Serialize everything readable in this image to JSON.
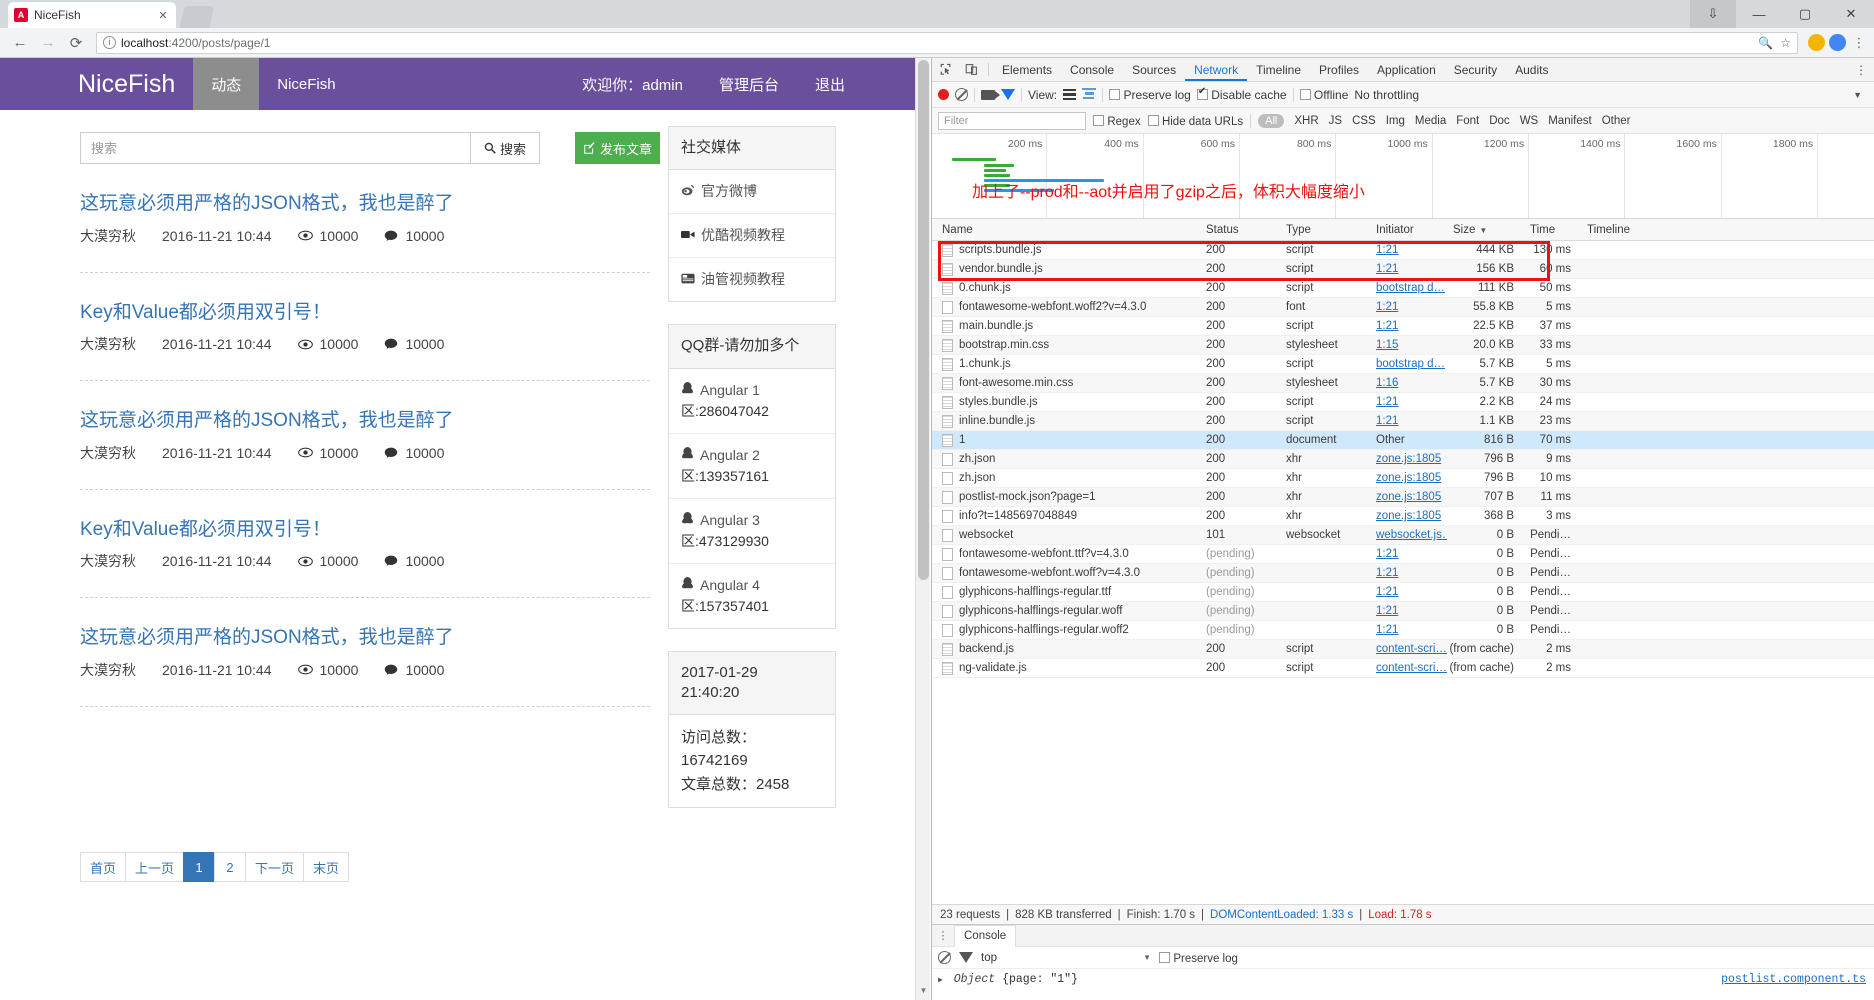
{
  "browser": {
    "tab": {
      "title": "NiceFish",
      "favicon_letter": "A",
      "close_label": "✕"
    },
    "window": {
      "minimize": "—",
      "maximize": "▢",
      "close": "✕",
      "download": "⇩"
    },
    "nav": {
      "back": "←",
      "forward": "→",
      "reload": "⟳"
    },
    "omnibox": {
      "info_icon": "ⓘ",
      "url_host": "localhost",
      "url_rest": ":4200/posts/page/1",
      "zoom_icon": "🔍",
      "star_icon": "☆"
    }
  },
  "site": {
    "brand": "NiceFish",
    "nav_items": [
      {
        "label": "动态",
        "active": true
      },
      {
        "label": "NiceFish",
        "active": false
      }
    ],
    "nav_right": [
      {
        "label": "欢迎你：admin"
      },
      {
        "label": "管理后台"
      },
      {
        "label": "退出"
      }
    ],
    "search": {
      "placeholder": "搜索",
      "button_label": "搜索",
      "icon": "search-icon",
      "value": ""
    },
    "publish_button": {
      "label": "发布文章",
      "icon": "pencil-square-icon"
    },
    "posts": [
      {
        "title": "这玩意必须用严格的JSON格式，我也是醉了",
        "author": "大漠穷秋",
        "date": "2016-11-21 10:44",
        "views": "10000",
        "comments": "10000"
      },
      {
        "title": "Key和Value都必须用双引号！",
        "author": "大漠穷秋",
        "date": "2016-11-21 10:44",
        "views": "10000",
        "comments": "10000"
      },
      {
        "title": "这玩意必须用严格的JSON格式，我也是醉了",
        "author": "大漠穷秋",
        "date": "2016-11-21 10:44",
        "views": "10000",
        "comments": "10000"
      },
      {
        "title": "Key和Value都必须用双引号！",
        "author": "大漠穷秋",
        "date": "2016-11-21 10:44",
        "views": "10000",
        "comments": "10000"
      },
      {
        "title": "这玩意必须用严格的JSON格式，我也是醉了",
        "author": "大漠穷秋",
        "date": "2016-11-21 10:44",
        "views": "10000",
        "comments": "10000"
      }
    ],
    "pagination": [
      {
        "label": "首页",
        "active": false
      },
      {
        "label": "上一页",
        "active": false
      },
      {
        "label": "1",
        "active": true
      },
      {
        "label": "2",
        "active": false
      },
      {
        "label": "下一页",
        "active": false
      },
      {
        "label": "末页",
        "active": false
      }
    ],
    "widgets": {
      "social": {
        "title": "社交媒体",
        "items": [
          {
            "label": "官方微博",
            "icon": "weibo-icon"
          },
          {
            "label": "优酷视频教程",
            "icon": "video-camera-icon"
          },
          {
            "label": "油管视频教程",
            "icon": "youtube-icon"
          }
        ]
      },
      "qq": {
        "title": "QQ群-请勿加多个",
        "items": [
          {
            "name": "Angular 1",
            "number": "区:286047042",
            "icon": "qq-icon"
          },
          {
            "name": "Angular 2",
            "number": "区:139357161",
            "icon": "qq-icon"
          },
          {
            "name": "Angular 3",
            "number": "区:473129930",
            "icon": "qq-icon"
          },
          {
            "name": "Angular 4",
            "number": "区:157357401",
            "icon": "qq-icon"
          }
        ]
      },
      "stats": {
        "datetime_date": "2017-01-29",
        "datetime_time": "21:40:20",
        "visits_label": "访问总数：",
        "visits_value": "16742169",
        "posts_label": "文章总数：2458"
      }
    }
  },
  "devtools": {
    "tabs": [
      {
        "label": "Elements",
        "active": false
      },
      {
        "label": "Console",
        "active": false
      },
      {
        "label": "Sources",
        "active": false
      },
      {
        "label": "Network",
        "active": true
      },
      {
        "label": "Timeline",
        "active": false
      },
      {
        "label": "Profiles",
        "active": false
      },
      {
        "label": "Application",
        "active": false
      },
      {
        "label": "Security",
        "active": false
      },
      {
        "label": "Audits",
        "active": false
      }
    ],
    "more_icon": "⋮",
    "inspect_icon": "cursor-arrow-icon",
    "device_icon": "device-toolbar-icon",
    "toolbar": {
      "record_icon": "record-icon",
      "clear_icon": "clear-icon",
      "capture_icon": "camera-icon",
      "filter_icon": "funnel-icon",
      "view_label": "View:",
      "view_list_icon": "list-view-icon",
      "view_waterfall_icon": "waterfall-view-icon",
      "preserve_log": {
        "label": "Preserve log",
        "checked": false
      },
      "disable_cache": {
        "label": "Disable cache",
        "checked": true
      },
      "offline": {
        "label": "Offline",
        "checked": false
      },
      "throttling": "No throttling",
      "throttling_arrow": "▼"
    },
    "filterbar": {
      "filter_placeholder": "Filter",
      "filter_value": "",
      "regex": {
        "label": "Regex",
        "checked": false
      },
      "hide_data_urls": {
        "label": "Hide data URLs",
        "checked": false
      },
      "types": [
        "All",
        "XHR",
        "JS",
        "CSS",
        "Img",
        "Media",
        "Font",
        "Doc",
        "WS",
        "Manifest",
        "Other"
      ],
      "active_type": "All"
    },
    "overview": {
      "ticks": [
        "200 ms",
        "400 ms",
        "600 ms",
        "800 ms",
        "1000 ms",
        "1200 ms",
        "1400 ms",
        "1600 ms",
        "1800 ms"
      ],
      "annotation": "加上了--prod和--aot并启用了gzip之后，体积大幅度缩小",
      "annotation_color": "#ee1111"
    },
    "columns": [
      "Name",
      "Status",
      "Type",
      "Initiator",
      "Size",
      "Time",
      "Timeline"
    ],
    "sorted_column": "Size",
    "sort_arrow": "▼",
    "requests": [
      {
        "name": "scripts.bundle.js",
        "status": "200",
        "type": "script",
        "initiator": "1:21",
        "size": "444 KB",
        "time": "130 ms",
        "icon": "script-file-icon",
        "highlight": true
      },
      {
        "name": "vendor.bundle.js",
        "status": "200",
        "type": "script",
        "initiator": "1:21",
        "size": "156 KB",
        "time": "60 ms",
        "icon": "script-file-icon",
        "highlight": true
      },
      {
        "name": "0.chunk.js",
        "status": "200",
        "type": "script",
        "initiator": "bootstrap d…",
        "size": "111 KB",
        "time": "50 ms",
        "icon": "script-file-icon"
      },
      {
        "name": "fontawesome-webfont.woff2?v=4.3.0",
        "status": "200",
        "type": "font",
        "initiator": "1:21",
        "size": "55.8 KB",
        "time": "5 ms",
        "icon": "plain-file-icon"
      },
      {
        "name": "main.bundle.js",
        "status": "200",
        "type": "script",
        "initiator": "1:21",
        "size": "22.5 KB",
        "time": "37 ms",
        "icon": "script-file-icon"
      },
      {
        "name": "bootstrap.min.css",
        "status": "200",
        "type": "stylesheet",
        "initiator": "1:15",
        "size": "20.0 KB",
        "time": "33 ms",
        "icon": "script-file-icon"
      },
      {
        "name": "1.chunk.js",
        "status": "200",
        "type": "script",
        "initiator": "bootstrap d…",
        "size": "5.7 KB",
        "time": "5 ms",
        "icon": "script-file-icon"
      },
      {
        "name": "font-awesome.min.css",
        "status": "200",
        "type": "stylesheet",
        "initiator": "1:16",
        "size": "5.7 KB",
        "time": "30 ms",
        "icon": "script-file-icon"
      },
      {
        "name": "styles.bundle.js",
        "status": "200",
        "type": "script",
        "initiator": "1:21",
        "size": "2.2 KB",
        "time": "24 ms",
        "icon": "script-file-icon"
      },
      {
        "name": "inline.bundle.js",
        "status": "200",
        "type": "script",
        "initiator": "1:21",
        "size": "1.1 KB",
        "time": "23 ms",
        "icon": "script-file-icon"
      },
      {
        "name": "1",
        "status": "200",
        "type": "document",
        "initiator": "Other",
        "size": "816 B",
        "time": "70 ms",
        "icon": "script-file-icon",
        "selected": true
      },
      {
        "name": "zh.json",
        "status": "200",
        "type": "xhr",
        "initiator": "zone.js:1805",
        "size": "796 B",
        "time": "9 ms",
        "icon": "plain-file-icon"
      },
      {
        "name": "zh.json",
        "status": "200",
        "type": "xhr",
        "initiator": "zone.js:1805",
        "size": "796 B",
        "time": "10 ms",
        "icon": "plain-file-icon"
      },
      {
        "name": "postlist-mock.json?page=1",
        "status": "200",
        "type": "xhr",
        "initiator": "zone.js:1805",
        "size": "707 B",
        "time": "11 ms",
        "icon": "plain-file-icon"
      },
      {
        "name": "info?t=1485697048849",
        "status": "200",
        "type": "xhr",
        "initiator": "zone.js:1805",
        "size": "368 B",
        "time": "3 ms",
        "icon": "plain-file-icon"
      },
      {
        "name": "websocket",
        "status": "101",
        "type": "websocket",
        "initiator": "websocket.js…",
        "size": "0 B",
        "time": "Pendi…",
        "icon": "plain-file-icon"
      },
      {
        "name": "fontawesome-webfont.ttf?v=4.3.0",
        "status": "(pending)",
        "type": "",
        "initiator": "1:21",
        "size": "0 B",
        "time": "Pendi…",
        "icon": "plain-file-icon"
      },
      {
        "name": "fontawesome-webfont.woff?v=4.3.0",
        "status": "(pending)",
        "type": "",
        "initiator": "1:21",
        "size": "0 B",
        "time": "Pendi…",
        "icon": "plain-file-icon"
      },
      {
        "name": "glyphicons-halflings-regular.ttf",
        "status": "(pending)",
        "type": "",
        "initiator": "1:21",
        "size": "0 B",
        "time": "Pendi…",
        "icon": "plain-file-icon"
      },
      {
        "name": "glyphicons-halflings-regular.woff",
        "status": "(pending)",
        "type": "",
        "initiator": "1:21",
        "size": "0 B",
        "time": "Pendi…",
        "icon": "plain-file-icon"
      },
      {
        "name": "glyphicons-halflings-regular.woff2",
        "status": "(pending)",
        "type": "",
        "initiator": "1:21",
        "size": "0 B",
        "time": "Pendi…",
        "icon": "plain-file-icon"
      },
      {
        "name": "backend.js",
        "status": "200",
        "type": "script",
        "initiator": "content-scri…",
        "size": "(from cache)",
        "time": "2 ms",
        "icon": "script-file-icon"
      },
      {
        "name": "ng-validate.js",
        "status": "200",
        "type": "script",
        "initiator": "content-scri…",
        "size": "(from cache)",
        "time": "2 ms",
        "icon": "script-file-icon"
      }
    ],
    "summary": {
      "requests": "23 requests",
      "transferred": "828 KB transferred",
      "finish": "Finish: 1.70 s",
      "dcl": "DOMContentLoaded: 1.33 s",
      "load": "Load: 1.78 s"
    },
    "drawer": {
      "tab_label": "Console",
      "kebab_icon": "⋮",
      "clear_icon": "clear-icon",
      "filter_icon": "funnel-icon",
      "context": "top",
      "context_arrow": "▼",
      "preserve_log": {
        "label": "Preserve log",
        "checked": false
      },
      "log_prefix": "Object",
      "log_body": "{page: \"1\"}",
      "log_source": "postlist.component.ts"
    }
  }
}
